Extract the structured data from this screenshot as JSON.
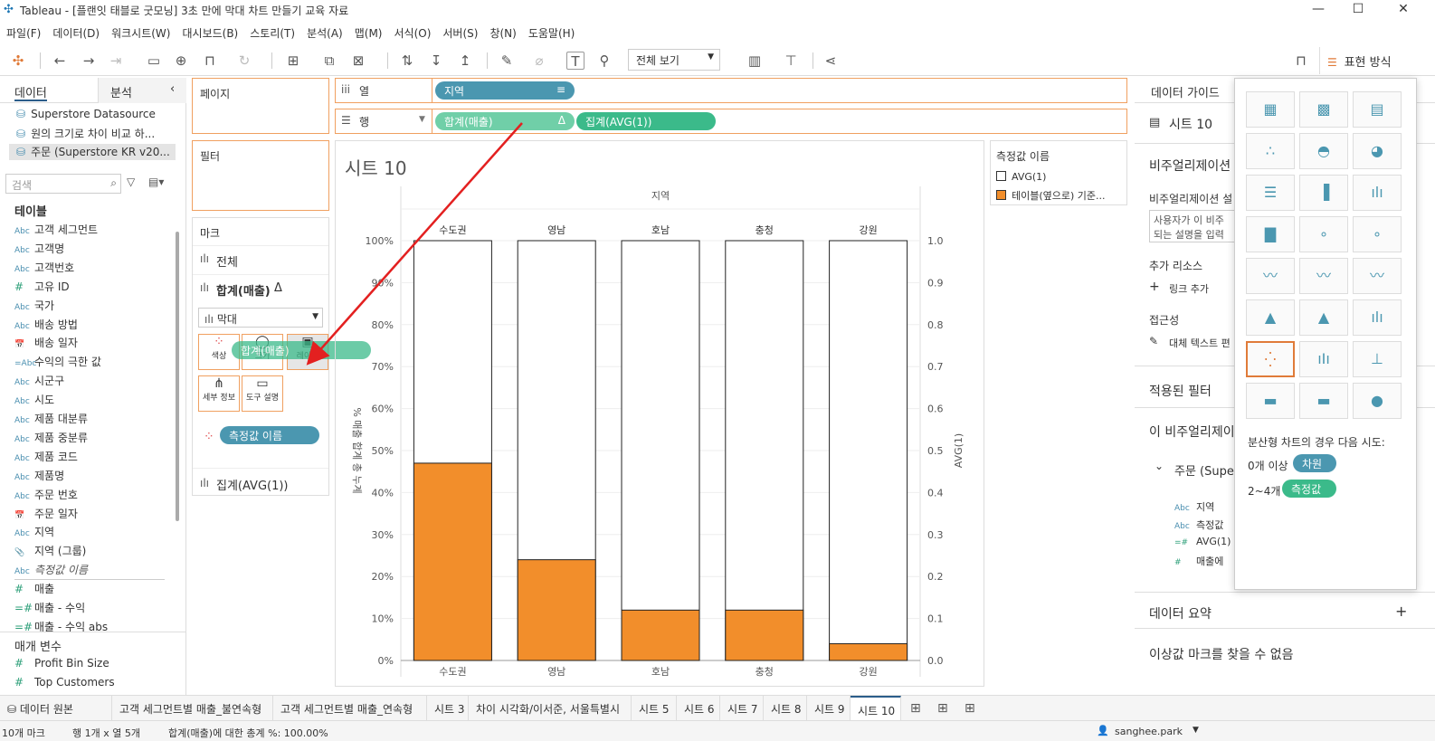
{
  "window": {
    "title": "Tableau - [플랜잇 태블로 굿모닝] 3초 만에 막대 차트 만들기 교육 자료",
    "minimize": "—",
    "maximize": "☐",
    "close": "✕"
  },
  "menu": [
    "파일(F)",
    "데이터(D)",
    "워크시트(W)",
    "대시보드(B)",
    "스토리(T)",
    "분석(A)",
    "맵(M)",
    "서식(O)",
    "서버(S)",
    "창(N)",
    "도움말(H)"
  ],
  "toolbar": {
    "fit_select": "전체 보기",
    "show_me_label": "표현 방식"
  },
  "left": {
    "tab_data": "데이터",
    "tab_analysis": "분석",
    "datasources": [
      "Superstore Datasource",
      "원의 크기로 차이 비교 하...",
      "주문 (Superstore KR v20..."
    ],
    "search_placeholder": "검색",
    "tables_header": "테이블",
    "fields": [
      {
        "type": "Abc",
        "name": "고객 세그먼트"
      },
      {
        "type": "Abc",
        "name": "고객명"
      },
      {
        "type": "Abc",
        "name": "고객번호"
      },
      {
        "type": "#",
        "name": "고유 ID"
      },
      {
        "type": "Abc",
        "name": "국가"
      },
      {
        "type": "Abc",
        "name": "배송 방법"
      },
      {
        "type": "📅",
        "name": "배송 일자"
      },
      {
        "type": "=Abc",
        "name": "수익의 극한 값"
      },
      {
        "type": "Abc",
        "name": "시군구"
      },
      {
        "type": "Abc",
        "name": "시도"
      },
      {
        "type": "Abc",
        "name": "제품 대분류"
      },
      {
        "type": "Abc",
        "name": "제품 중분류"
      },
      {
        "type": "Abc",
        "name": "제품 코드"
      },
      {
        "type": "Abc",
        "name": "제품명"
      },
      {
        "type": "Abc",
        "name": "주문 번호"
      },
      {
        "type": "📅",
        "name": "주문 일자"
      },
      {
        "type": "Abc",
        "name": "지역"
      },
      {
        "type": "📎",
        "name": "지역 (그룹)"
      },
      {
        "type": "Abc",
        "name": "측정값 이름"
      }
    ],
    "measures": [
      {
        "type": "#",
        "name": "매출"
      },
      {
        "type": "=#",
        "name": "매출 - 수익"
      },
      {
        "type": "=#",
        "name": "매출 - 수익 abs"
      }
    ],
    "params_header": "매개 변수",
    "params": [
      {
        "type": "#",
        "name": "Profit Bin Size"
      },
      {
        "type": "#",
        "name": "Top Customers"
      }
    ]
  },
  "cards": {
    "pages": "페이지",
    "filters": "필터",
    "marks": "마크",
    "all": "전체",
    "sum_sales": "합계(매출)",
    "delta": "Δ",
    "mark_type": "막대",
    "color": "색상",
    "size": "크기",
    "label": "레이블",
    "detail": "세부 정보",
    "tooltip": "도구 설명",
    "measure_names_pill": "측정값 이름",
    "avg_card": "집계(AVG(1))",
    "drag_pill": "합계(매출)"
  },
  "shelves": {
    "columns_label": "열",
    "rows_label": "행",
    "col_pill": "지역",
    "row_pill1": "합계(매출)",
    "row_pill2": "집계(AVG(1))"
  },
  "legend": {
    "title": "측정값 이름",
    "items": [
      {
        "name": "AVG(1)",
        "color": "#ffffff"
      },
      {
        "name": "테이블(옆으로) 기준...",
        "color": "#f28e2b"
      }
    ]
  },
  "sheet_title": "시트 10",
  "chart_data": {
    "type": "bar",
    "header": "지역",
    "categories": [
      "수도권",
      "영남",
      "호남",
      "충청",
      "강원"
    ],
    "series": [
      {
        "values": [
          47,
          24,
          12,
          12,
          4
        ]
      },
      {
        "name": "AVG(1)",
        "values": [
          1,
          1,
          1,
          1,
          1
        ]
      }
    ],
    "ylabel": "% 매출 합계 총 누계",
    "y2label": "AVG(1)",
    "yticks": [
      "100%",
      "90%",
      "80%",
      "70%",
      "60%",
      "50%",
      "40%",
      "30%",
      "20%",
      "10%",
      "0%"
    ],
    "y2ticks": [
      "1.0",
      "0.9",
      "0.8",
      "0.7",
      "0.6",
      "0.5",
      "0.4",
      "0.3",
      "0.2",
      "0.1",
      "0.0"
    ],
    "ylim": [
      0,
      100
    ],
    "bar_color": "#f28e2b"
  },
  "right": {
    "tab": "데이터 가이드",
    "sheet": "시트 10",
    "viz_header": "비주얼리제이션",
    "viz_desc_label": "비주얼리제이션 설",
    "viz_desc_text": "사용자가 이 비주\n되는 설명을 입력",
    "resources": "추가 리소스",
    "add_link": "링크 추가",
    "accessibility": "접근성",
    "alt_text": "대체 텍스트 편",
    "applied_filters": "적용된 필터",
    "this_viz": "이 비주얼리제이",
    "source": "주문 (Supe",
    "fields": [
      {
        "type": "Abc",
        "name": "지역"
      },
      {
        "type": "Abc",
        "name": "측정값"
      },
      {
        "type": "=#",
        "name": "AVG(1)"
      },
      {
        "type": "#",
        "name": "매출에"
      }
    ],
    "data_summary": "데이터 요약",
    "plus": "+",
    "no_outliers": "이상값 마크를 찾을 수 없음"
  },
  "showme": {
    "hint": "분산형 차트의 경우 다음 시도:",
    "row1_label": "0개 이상",
    "row1_pill": "차원",
    "row2_label": "2~4개",
    "row2_pill": "측정값"
  },
  "sheets": {
    "datasource": "데이터 원본",
    "tabs": [
      "고객 세그먼트별 매출_불연속형",
      "고객 세그먼트별 매출_연속형",
      "시트 3",
      "차이 시각화/이서준, 서울특별시",
      "시트 5",
      "시트 6",
      "시트 7",
      "시트 8",
      "시트 9",
      "시트 10"
    ],
    "active": "시트 10"
  },
  "status": {
    "marks": "10개 마크",
    "rows_cols": "행 1개 x 열 5개",
    "summary": "합계(매출)에 대한 총계 %: 100.00%",
    "user": "sanghee.park"
  }
}
